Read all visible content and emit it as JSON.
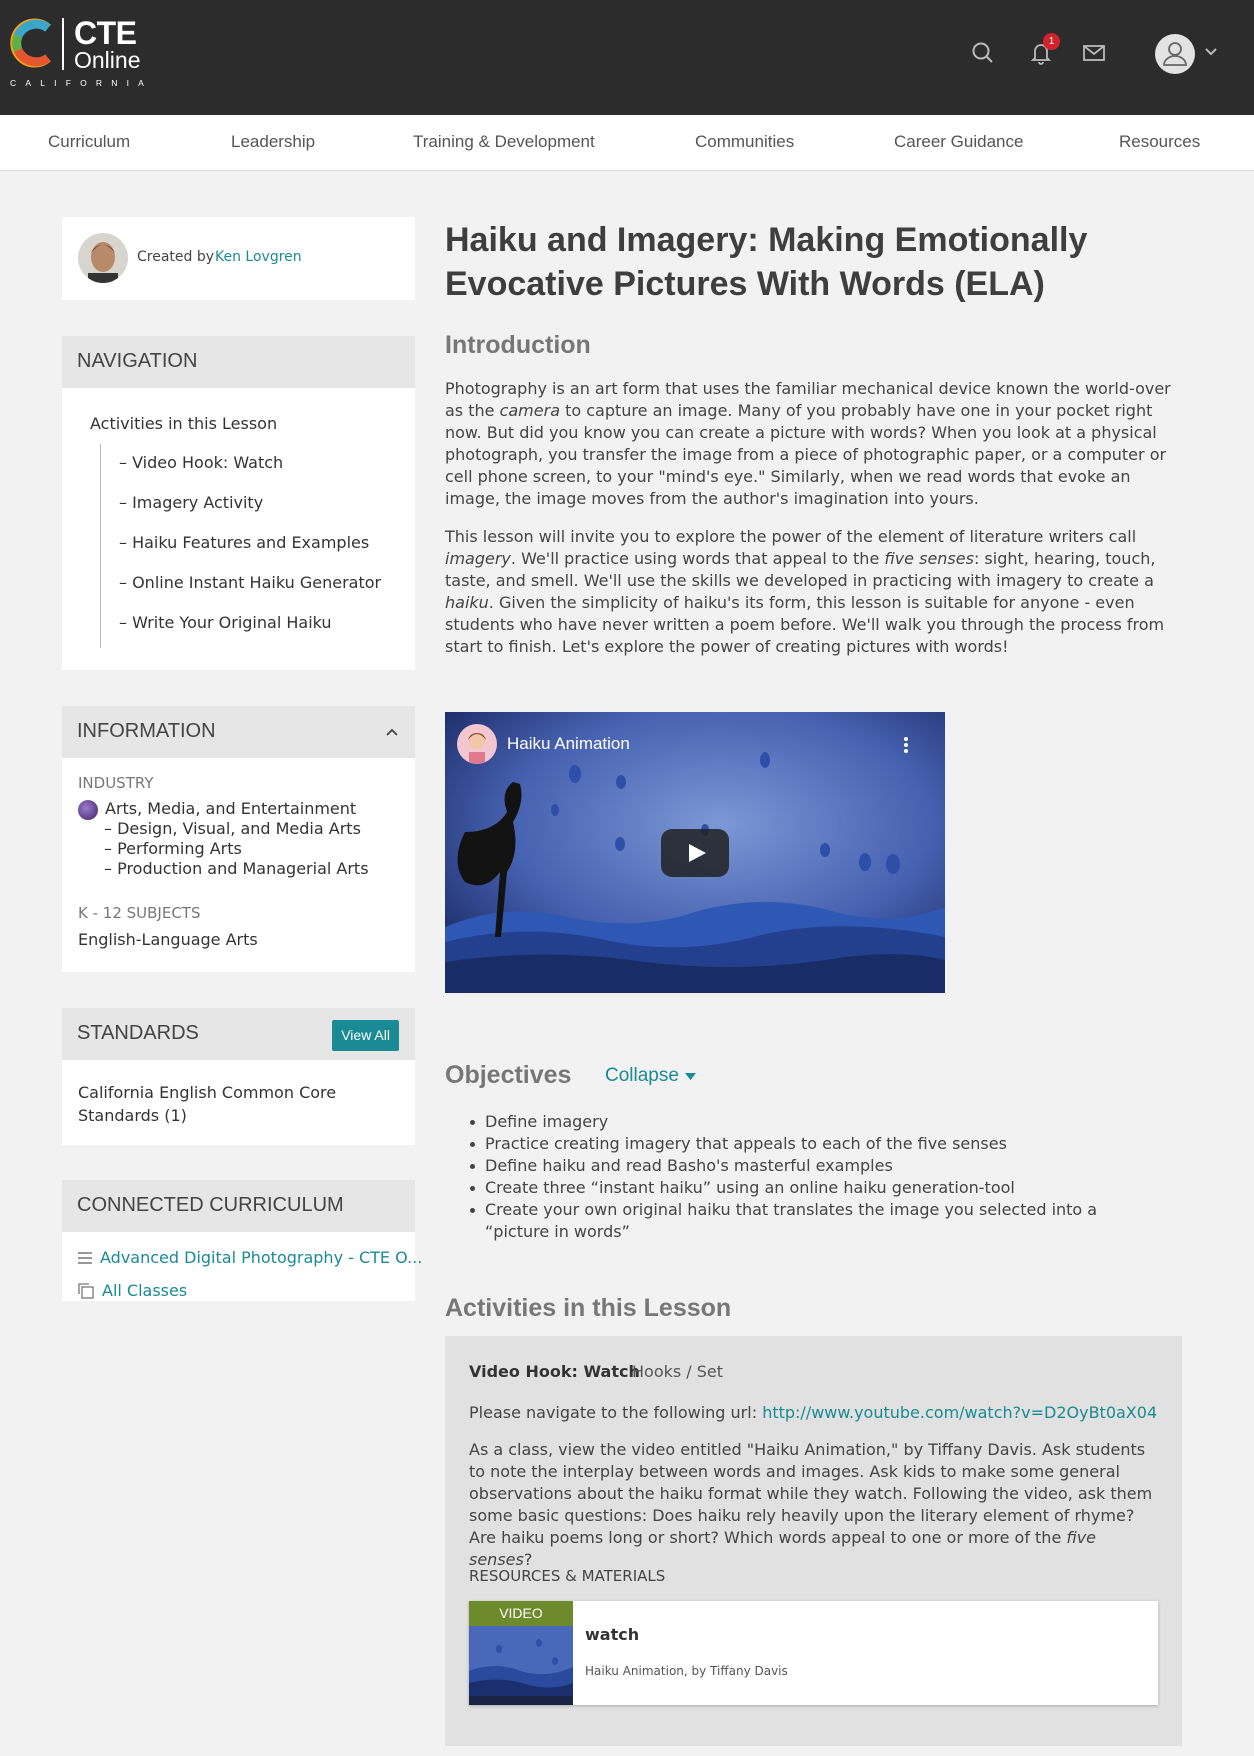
{
  "header": {
    "logo": {
      "name": "CTE",
      "subname": "Online",
      "tagline": "CALIFORNIA"
    },
    "notification_count": "1"
  },
  "nav": {
    "items": [
      "Curriculum",
      "Leadership",
      "Training & Development",
      "Communities",
      "Career Guidance",
      "Resources"
    ]
  },
  "author": {
    "prefix": "Created by",
    "name": "Ken Lovgren"
  },
  "navigation": {
    "heading": "NAVIGATION",
    "root": "Activities in this Lesson",
    "items": [
      "– Video Hook: Watch",
      "– Imagery Activity",
      "– Haiku Features and Examples",
      "– Online Instant Haiku Generator",
      "– Write Your Original Haiku"
    ]
  },
  "information": {
    "heading": "INFORMATION",
    "industry_label": "INDUSTRY",
    "industry": "Arts, Media, and Entertainment",
    "sub_industries": [
      "– Design, Visual, and Media Arts",
      "– Performing Arts",
      "– Production and Managerial Arts"
    ],
    "subjects_label": "K - 12 SUBJECTS",
    "subject": "English-Language Arts"
  },
  "standards": {
    "heading": "STANDARDS",
    "view_all": "View All",
    "text": "California English Common Core Standards (1)"
  },
  "connected": {
    "heading": "CONNECTED CURRICULUM",
    "course": "Advanced Digital Photography - CTE O...",
    "all_classes": "All Classes"
  },
  "lesson": {
    "title": "Haiku and Imagery: Making Emotionally Evocative Pictures With Words (ELA)",
    "intro_heading": "Introduction",
    "intro_p1": [
      "Photography is an art form that uses the familiar mechanical device known the world-over as the ",
      "camera",
      " to capture an image. Many of you probably have one in your pocket right now. But did you know you can create a picture with words? When you look at a physical photograph, you transfer the image from a piece of photographic paper, or a computer or cell phone screen, to your \"mind's eye.\" Similarly, when we read words that evoke an image, the image moves from the author's imagination into yours."
    ],
    "intro_p2": [
      "This lesson will invite you to explore the power of the element of literature writers call ",
      "imagery",
      ". We'll practice using words that appeal to the ",
      "five senses",
      ": sight, hearing, touch, taste, and smell. We'll use the skills we developed in practicing with imagery to create a ",
      "haiku",
      ". Given the simplicity of haiku's its form, this lesson is suitable for anyone - even students who have never written a poem before. We'll walk you through the process from start to finish. Let's explore the power of creating pictures with words!"
    ],
    "video_title": "Haiku Animation",
    "objectives_heading": "Objectives",
    "collapse": "Collapse",
    "objectives": [
      "Define imagery",
      "Practice creating imagery that appeals to each of the five senses",
      "Define haiku and read Basho's masterful examples",
      "Create three “instant haiku” using an online haiku generation-tool",
      "Create your own original haiku that translates the image you selected into a “picture in words”"
    ],
    "activities_heading": "Activities in this Lesson"
  },
  "activity": {
    "title": "Video Hook: Watch",
    "tag": "Hooks / Set",
    "nav_prefix": "Please navigate to the following url: ",
    "url": "http://www.youtube.com/watch?v=D2OyBt0aX04",
    "body": [
      "As a class, view the video entitled \"Haiku Animation,\" by Tiffany Davis. Ask students to note the interplay between words and images. Ask kids to make some general observations about the haiku format while they watch. Following the video, ask them some basic questions: Does haiku rely heavily upon the literary element of rhyme? Are haiku poems long or short? Which words appeal to one or more of the ",
      "five senses",
      "?"
    ],
    "resources_label": "RESOURCES & MATERIALS",
    "resource": {
      "badge": "VIDEO",
      "name": "watch",
      "desc": "Haiku Animation, by Tiffany Davis"
    }
  },
  "colors": {
    "accent": "#1a8a94",
    "header_bg": "#2c2c2c",
    "badge": "#d2232a",
    "video_badge": "#6d8b2c"
  }
}
